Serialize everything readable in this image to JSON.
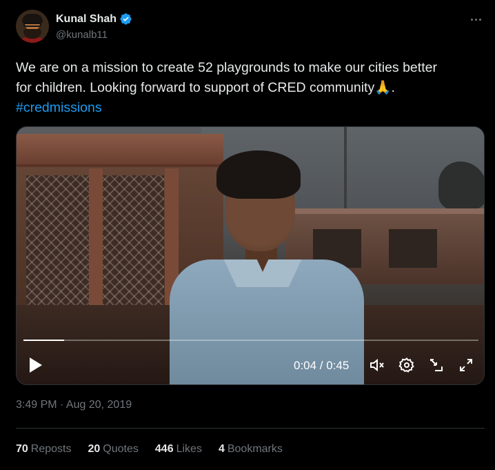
{
  "author": {
    "name": "Kunal Shah",
    "handle": "@kunalb11",
    "verified_color": "#1d9bf0"
  },
  "tweet": {
    "text_line1": "We are on a mission to create 52 playgrounds to make our cities better",
    "text_line2": "for children. Looking forward to support of CRED community",
    "emoji": "🙏",
    "period": ".",
    "hashtag": "#credmissions",
    "timestamp": "3:49 PM · Aug 20, 2019"
  },
  "video": {
    "current_time": "0:04",
    "duration": "0:45",
    "time_display": "0:04 / 0:45",
    "progress_fraction": 0.089
  },
  "stats": [
    {
      "count": "70",
      "label": "Reposts"
    },
    {
      "count": "20",
      "label": "Quotes"
    },
    {
      "count": "446",
      "label": "Likes"
    },
    {
      "count": "4",
      "label": "Bookmarks"
    }
  ],
  "colors": {
    "accent": "#1d9bf0",
    "secondary_text": "#71767b",
    "primary_text": "#e7e9ea"
  }
}
